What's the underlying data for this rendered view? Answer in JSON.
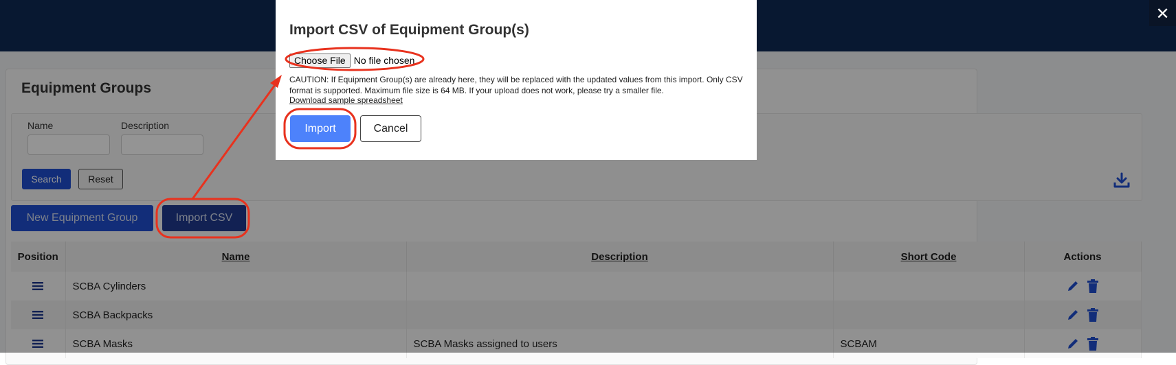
{
  "page": {
    "card_title": "Equipment Groups",
    "filters": {
      "name_label": "Name",
      "description_label": "Description",
      "search_label": "Search",
      "reset_label": "Reset"
    },
    "buttons": {
      "new_group_label": "New Equipment Group",
      "import_csv_label": "Import CSV"
    },
    "table": {
      "headers": [
        "Position",
        "Name",
        "Description",
        "Short Code",
        "Actions"
      ],
      "rows": [
        {
          "name": "SCBA Cylinders",
          "description": "",
          "short_code": ""
        },
        {
          "name": "SCBA Backpacks",
          "description": "",
          "short_code": ""
        },
        {
          "name": "SCBA Masks",
          "description": "SCBA Masks assigned to users",
          "short_code": "SCBAM"
        }
      ]
    }
  },
  "modal": {
    "title": "Import CSV of Equipment Group(s)",
    "choose_file_label": "Choose File",
    "no_file_text": "No file chosen",
    "caution_text": "CAUTION: If Equipment Group(s) are already here, they will be replaced with the updated values from this import. Only CSV format is supported. Maximum file size is 64 MB. If your upload does not work, please try a smaller file.",
    "sample_link": "Download sample spreadsheet",
    "import_label": "Import",
    "cancel_label": "Cancel",
    "close_symbol": "✕"
  },
  "colors": {
    "header_navy": "#0f2a55",
    "primary_blue": "#1f4fd1",
    "modal_import_blue": "#4d82fb",
    "annotation_red": "#e8321e"
  }
}
